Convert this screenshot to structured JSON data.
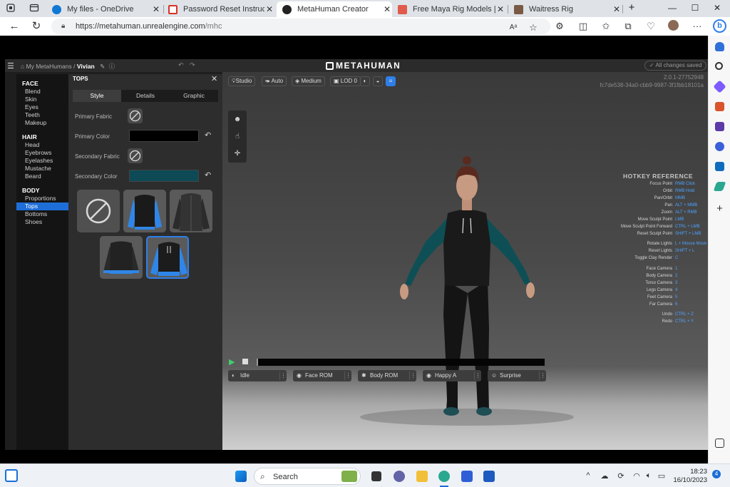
{
  "browser": {
    "tabs": [
      {
        "title": "My files - OneDrive",
        "favicon_color": "#0f78d4",
        "active": false
      },
      {
        "title": "Password Reset Instructions Fo",
        "favicon_color": "#d93025",
        "active": false
      },
      {
        "title": "MetaHuman Creator",
        "favicon_color": "#222222",
        "active": true
      },
      {
        "title": "Free Maya Rig Models | Turbo",
        "favicon_color": "#e05b4b",
        "active": false
      },
      {
        "title": "Waitress Rig",
        "favicon_color": "#7a5a44",
        "active": false
      }
    ],
    "tab_close": "✕",
    "new_tab": "+",
    "url_host": "https://metahuman.unrealengine.com",
    "url_path": "/mhc",
    "nav": {
      "back": "←",
      "refresh": "↻"
    },
    "window": {
      "minimize": "—",
      "maximize": "☐",
      "close": "✕"
    },
    "toolbar_icons": [
      "read-aloud-icon",
      "favorite-star-icon",
      "extensions-icon",
      "split-screen-icon",
      "favorites-icon",
      "collections-icon",
      "browser-essentials-icon",
      "profile-avatar-icon",
      "more-icon",
      "copilot-icon"
    ],
    "more": "···",
    "read_aloud": "Aᵃ"
  },
  "app": {
    "breadcrumb_root": "My MetaHumans /",
    "character_name": "Vivian",
    "logo": "METAHUMAN",
    "saved_status": "All changes saved",
    "categories": [
      {
        "header": "FACE",
        "items": [
          "Blend",
          "Skin",
          "Eyes",
          "Teeth",
          "Makeup"
        ]
      },
      {
        "header": "HAIR",
        "items": [
          "Head",
          "Eyebrows",
          "Eyelashes",
          "Mustache",
          "Beard"
        ]
      },
      {
        "header": "BODY",
        "items": [
          "Proportions",
          "Tops",
          "Bottoms",
          "Shoes"
        ]
      }
    ],
    "selected_category_item": "Tops",
    "panel": {
      "title": "TOPS",
      "subtabs": [
        "Style",
        "Details",
        "Graphic"
      ],
      "selected_subtab": "Style",
      "primary_fabric_label": "Primary Fabric",
      "primary_color_label": "Primary Color",
      "primary_color": "#000000",
      "secondary_fabric_label": "Secondary Fabric",
      "secondary_color_label": "Secondary Color",
      "secondary_color": "#0d4a55",
      "thumbnails": [
        {
          "name": "None",
          "selected": false
        },
        {
          "name": "Vest Hoodie",
          "selected": false
        },
        {
          "name": "Leather Jacket",
          "selected": false
        },
        {
          "name": "Crew Sweater",
          "selected": false
        },
        {
          "name": "Hoodie",
          "selected": true
        }
      ]
    },
    "viewport": {
      "pills": [
        "Studio",
        "Auto",
        "Medium",
        "LOD 0"
      ],
      "version": "2.0.1-27752948",
      "build_hash": "fc7de538-34a0-cbb9-9987-3f1fbb18101a",
      "hotkey_title": "HOTKEY REFERENCE",
      "hotkeys": [
        [
          [
            "Focus Point",
            "RMB Click"
          ],
          [
            "Orbit",
            "RMB Hold"
          ],
          [
            "Pan/Orbit",
            "MMB"
          ],
          [
            "Pan",
            "ALT + MMB"
          ],
          [
            "Zoom",
            "ALT + RMB"
          ],
          [
            "Move Sculpt Point",
            "LMB"
          ],
          [
            "Move Sculpt Point Forward",
            "CTRL + LMB"
          ],
          [
            "Reset Sculpt Point",
            "SHIFT + LMB"
          ]
        ],
        [
          [
            "Rotate Lights",
            "L + Mouse Move"
          ],
          [
            "Reset Lights",
            "SHIFT + L"
          ],
          [
            "Toggle Clay Render",
            "C"
          ]
        ],
        [
          [
            "Face Camera",
            "1"
          ],
          [
            "Body Camera",
            "2"
          ],
          [
            "Torso Camera",
            "3"
          ],
          [
            "Legs Camera",
            "4"
          ],
          [
            "Feet Camera",
            "5"
          ],
          [
            "Far Camera",
            "6"
          ]
        ],
        [
          [
            "Undo",
            "CTRL + Z"
          ],
          [
            "Redo",
            "CTRL + Y"
          ]
        ]
      ],
      "animations": [
        "Idle",
        "Face ROM",
        "Body ROM",
        "Happy A",
        "Surprise"
      ]
    }
  },
  "taskbar": {
    "search_label": "Search",
    "time": "18:23",
    "date": "16/10/2023",
    "notification_count": "4"
  }
}
